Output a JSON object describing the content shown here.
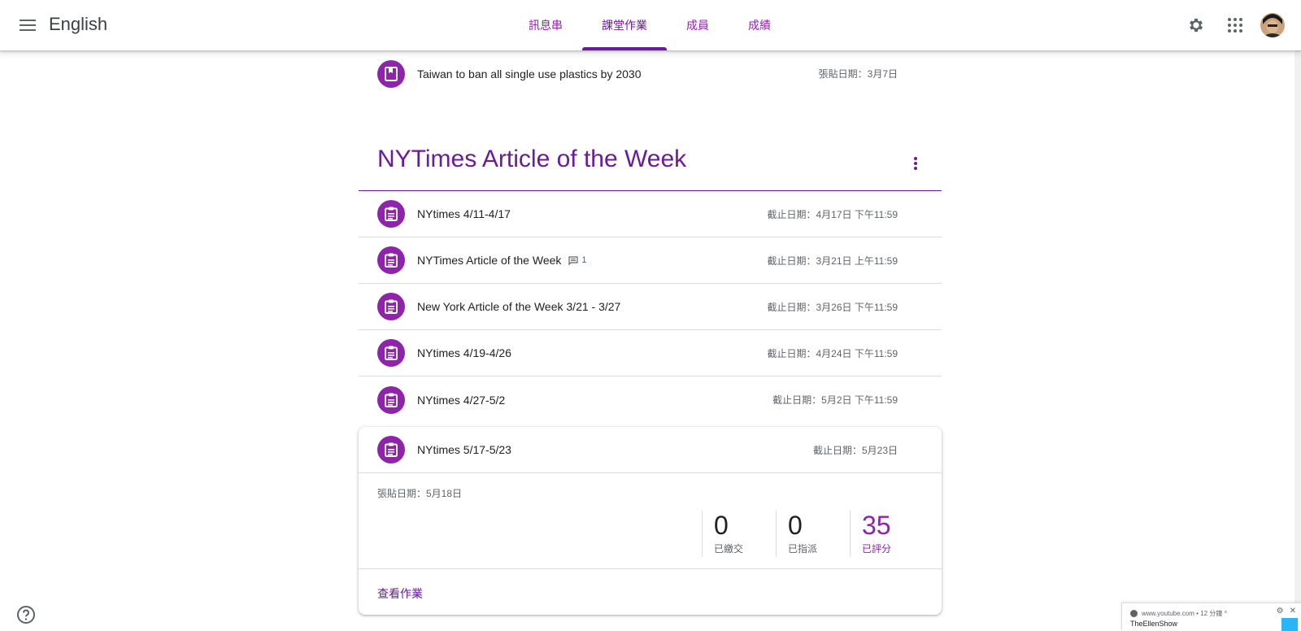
{
  "header": {
    "app_title": "English",
    "tabs": [
      {
        "label": "訊息串"
      },
      {
        "label": "課堂作業"
      },
      {
        "label": "成員"
      },
      {
        "label": "成績"
      }
    ]
  },
  "material": {
    "title": "Taiwan to ban all single use plastics by 2030",
    "date": "張貼日期：3月7日"
  },
  "topic": {
    "title": "NYTimes Article of the Week",
    "assignments": [
      {
        "title": "NYtimes 4/11-4/17",
        "date": "截止日期：4月17日 下午11:59"
      },
      {
        "title": "NYTimes Article of the Week",
        "comment_count": "1",
        "date": "截止日期：3月21日 上午11:59"
      },
      {
        "title": "New York Article of the Week 3/21 - 3/27",
        "date": "截止日期：3月26日 下午11:59"
      },
      {
        "title": "NYtimes 4/19-4/26",
        "date": "截止日期：4月24日 下午11:59"
      },
      {
        "title": "NYtimes 4/27-5/2",
        "date": "截止日期：5月2日 下午11:59"
      }
    ]
  },
  "expanded": {
    "title": "NYtimes 5/17-5/23",
    "date": "截止日期：5月23日",
    "posted": "張貼日期：5月18日",
    "stats": [
      {
        "num": "0",
        "label": "已繳交"
      },
      {
        "num": "0",
        "label": "已指派"
      },
      {
        "num": "35",
        "label": "已評分"
      }
    ],
    "view_link": "查看作業"
  },
  "popup": {
    "source": "www.youtube.com • 12 分鐘 ^",
    "name": "TheEllenShow"
  },
  "colors": {
    "accent": "#8e24aa",
    "accent_dark": "#6a1b9a"
  }
}
